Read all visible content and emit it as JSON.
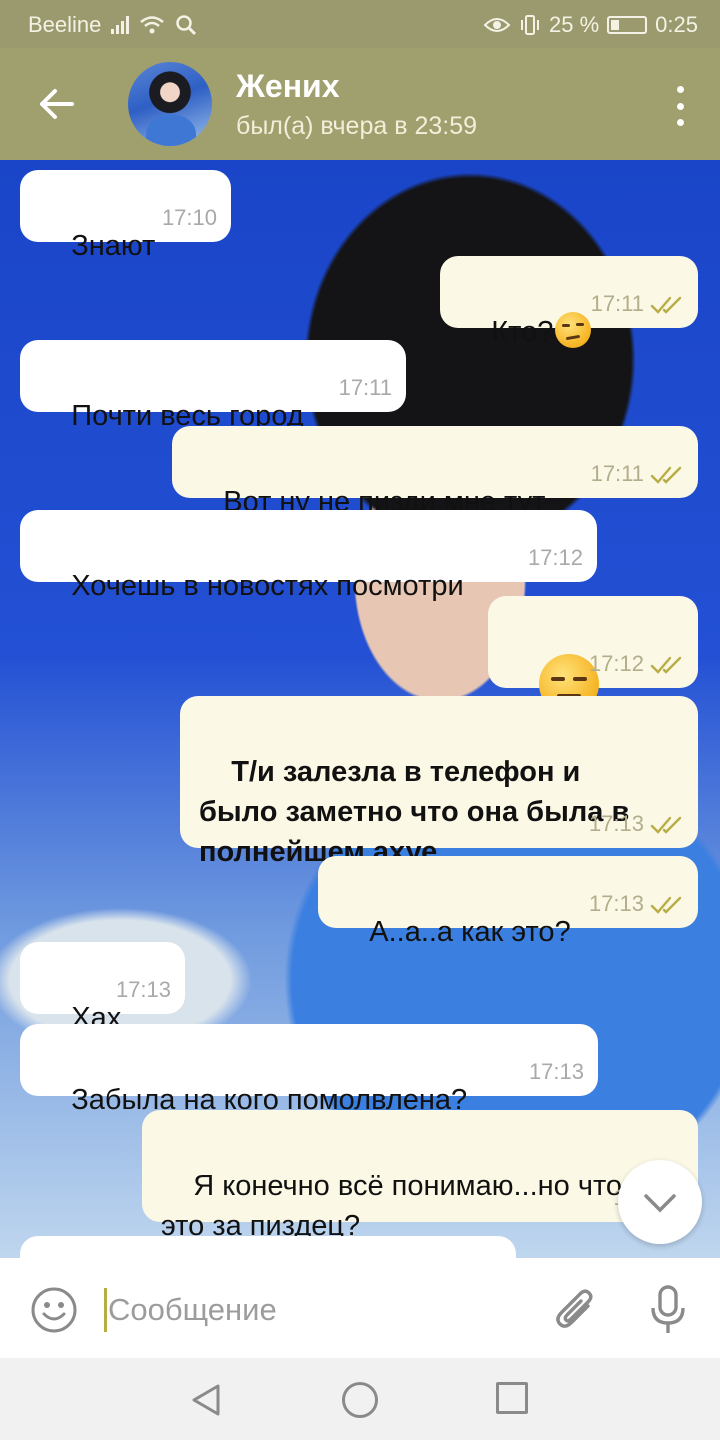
{
  "status_bar": {
    "carrier": "Beeline",
    "battery": "25 %",
    "time": "0:25"
  },
  "header": {
    "title": "Жених",
    "subtitle": "был(а) вчера в 23:59"
  },
  "messages": [
    {
      "text": "Знают",
      "time": "17:10",
      "dir": "in"
    },
    {
      "text": "Кто?",
      "time": "17:11",
      "dir": "out",
      "emoji": "raised-eyebrow-emoji"
    },
    {
      "text": "Почти весь город",
      "time": "17:11",
      "dir": "in"
    },
    {
      "text": "Вот ну не пизди мне тут",
      "time": "17:11",
      "dir": "out"
    },
    {
      "text": "Хочешь в новостях посмотри",
      "time": "17:12",
      "dir": "in"
    },
    {
      "text": "",
      "time": "17:12",
      "dir": "out",
      "emoji": "expressionless-face-emoji"
    },
    {
      "text": "Т/и залезла в телефон и\nбыло заметно что она была в\nполнейшем ахуе",
      "time": "17:13",
      "dir": "out",
      "bold": true
    },
    {
      "text": "А..а..а как это?",
      "time": "17:13",
      "dir": "out"
    },
    {
      "text": "Хах",
      "time": "17:13",
      "dir": "in"
    },
    {
      "text": "Забыла на кого помолвлена?",
      "time": "17:13",
      "dir": "in"
    },
    {
      "text": "Я конечно всё понимаю...но что\nэто за пиздец?",
      "time": "17:",
      "dir": "out"
    }
  ],
  "input": {
    "placeholder": "Сообщение"
  },
  "colors": {
    "header_bg": "#a09f6e",
    "status_bg": "#9a9a6e",
    "outgoing_bubble": "#fcf8e6",
    "incoming_bubble": "#ffffff",
    "check_color": "#b7ad44"
  }
}
